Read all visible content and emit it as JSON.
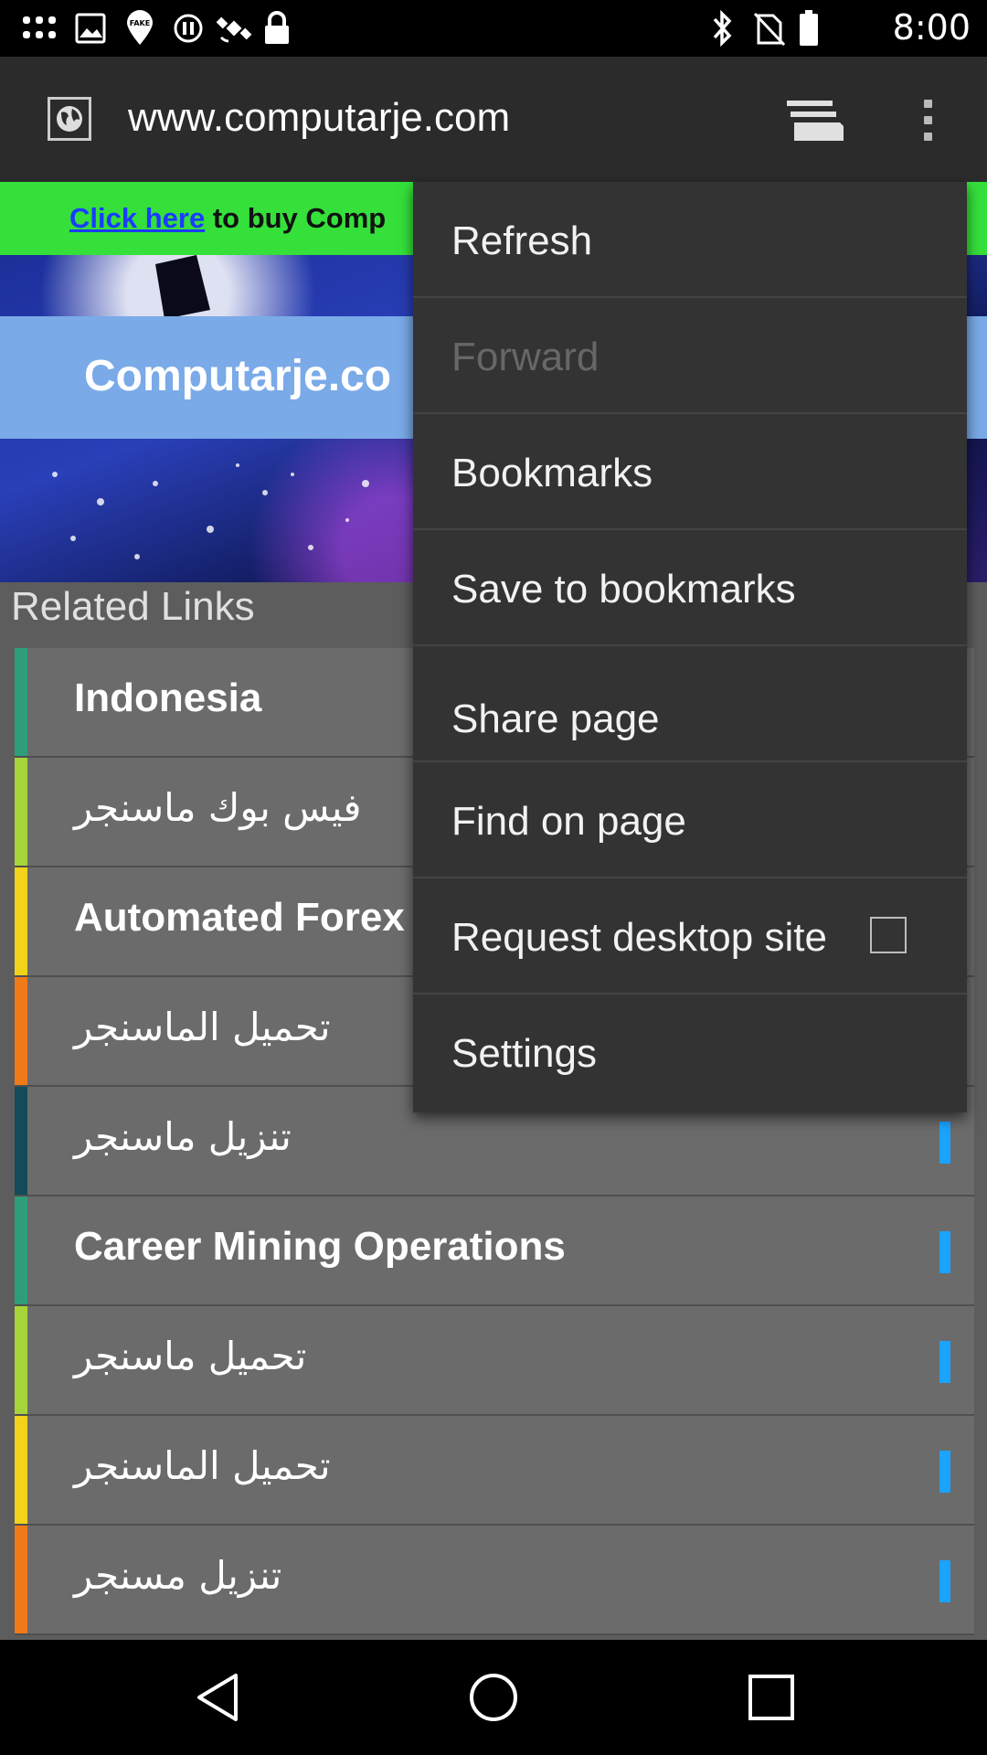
{
  "status_bar": {
    "time": "8:00",
    "icons": [
      "grid-icon",
      "image-icon",
      "fake-gps-icon",
      "sync-icon",
      "satellite-icon",
      "lock-icon",
      "bluetooth-icon",
      "no-sim-icon",
      "battery-icon"
    ],
    "fake_gps_badge": "FAKE"
  },
  "toolbar": {
    "url": "www.computarje.com",
    "site_icon": "globe-icon",
    "tabs_icon": "tabs-icon",
    "overflow_icon": "more-vert-icon"
  },
  "page": {
    "banner_link": "Click here",
    "banner_rest": " to buy Comp",
    "hero_title": "Computarje.co",
    "related_title": "Related Links",
    "links": [
      {
        "label": "Indonesia",
        "bold": true,
        "stripe": "#2e9e7a"
      },
      {
        "label": "فيس بوك ماسنجر",
        "bold": false,
        "stripe": "#a7d43a"
      },
      {
        "label": "Automated Forex",
        "bold": true,
        "stripe": "#f2d21b"
      },
      {
        "label": "تحميل الماسنجر",
        "bold": false,
        "stripe": "#f07a1a"
      },
      {
        "label": "تنزيل ماسنجر",
        "bold": false,
        "stripe": "#134b5a"
      },
      {
        "label": "Career Mining Operations",
        "bold": true,
        "stripe": "#2e9e7a"
      },
      {
        "label": "تحميل ماسنجر",
        "bold": false,
        "stripe": "#a7d43a"
      },
      {
        "label": "تحميل الماسنجر",
        "bold": false,
        "stripe": "#f2d21b"
      },
      {
        "label": "تنزيل مسنجر",
        "bold": false,
        "stripe": "#f07a1a"
      }
    ],
    "link_marker_color": "#1aa3ff"
  },
  "menu": {
    "items": [
      {
        "label": "Refresh",
        "enabled": true
      },
      {
        "label": "Forward",
        "enabled": false
      },
      {
        "label": "Bookmarks",
        "enabled": true
      },
      {
        "label": "Save to bookmarks",
        "enabled": true
      },
      {
        "label": "Share page",
        "enabled": true
      },
      {
        "label": "Find on page",
        "enabled": true
      },
      {
        "label": "Request desktop site",
        "enabled": true,
        "checked": false
      },
      {
        "label": "Settings",
        "enabled": true
      }
    ]
  },
  "nav_bar": {
    "buttons": [
      "back-icon",
      "home-icon",
      "recents-icon"
    ]
  }
}
